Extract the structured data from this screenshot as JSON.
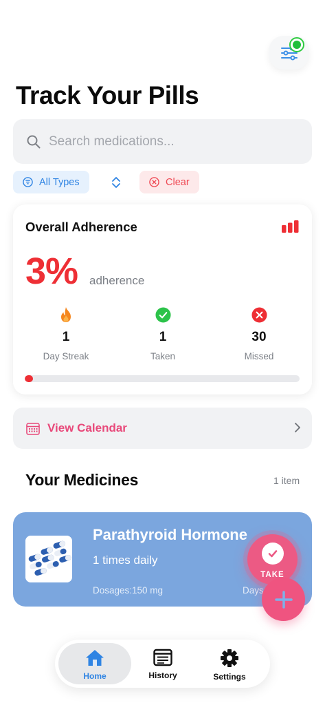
{
  "header": {
    "title": "Track Your Pills",
    "filter_button_icon": "sliders-icon",
    "filter_active_indicator_color": "#1fbf3a"
  },
  "search": {
    "placeholder": "Search medications...",
    "value": ""
  },
  "filters": {
    "type_chip_label": "All Types",
    "clear_chip_label": "Clear"
  },
  "adherence": {
    "title": "Overall Adherence",
    "percent_text": "3%",
    "percent_label": "adherence",
    "progress_fraction": 0.03,
    "stats": [
      {
        "value": "1",
        "label": "Day Streak",
        "icon": "flame-icon"
      },
      {
        "value": "1",
        "label": "Taken",
        "icon": "check-circle-icon"
      },
      {
        "value": "30",
        "label": "Missed",
        "icon": "x-circle-icon"
      }
    ]
  },
  "calendar": {
    "label": "View Calendar"
  },
  "medicines": {
    "title": "Your Medicines",
    "count_label": "1 item",
    "items": [
      {
        "name": "Parathyroid Hormone",
        "frequency": "1 times daily",
        "dosage": "Dosages:150 mg",
        "days": "Days"
      }
    ],
    "take_label": "TAKE"
  },
  "tabbar": {
    "tabs": [
      {
        "label": "Home",
        "icon": "home-icon",
        "active": true
      },
      {
        "label": "History",
        "icon": "history-icon",
        "active": false
      },
      {
        "label": "Settings",
        "icon": "gear-icon",
        "active": false
      }
    ]
  },
  "colors": {
    "accent_blue": "#2f84e3",
    "danger_red": "#ee2f35",
    "pink": "#ec5a84",
    "card_blue": "#7ba6de"
  }
}
